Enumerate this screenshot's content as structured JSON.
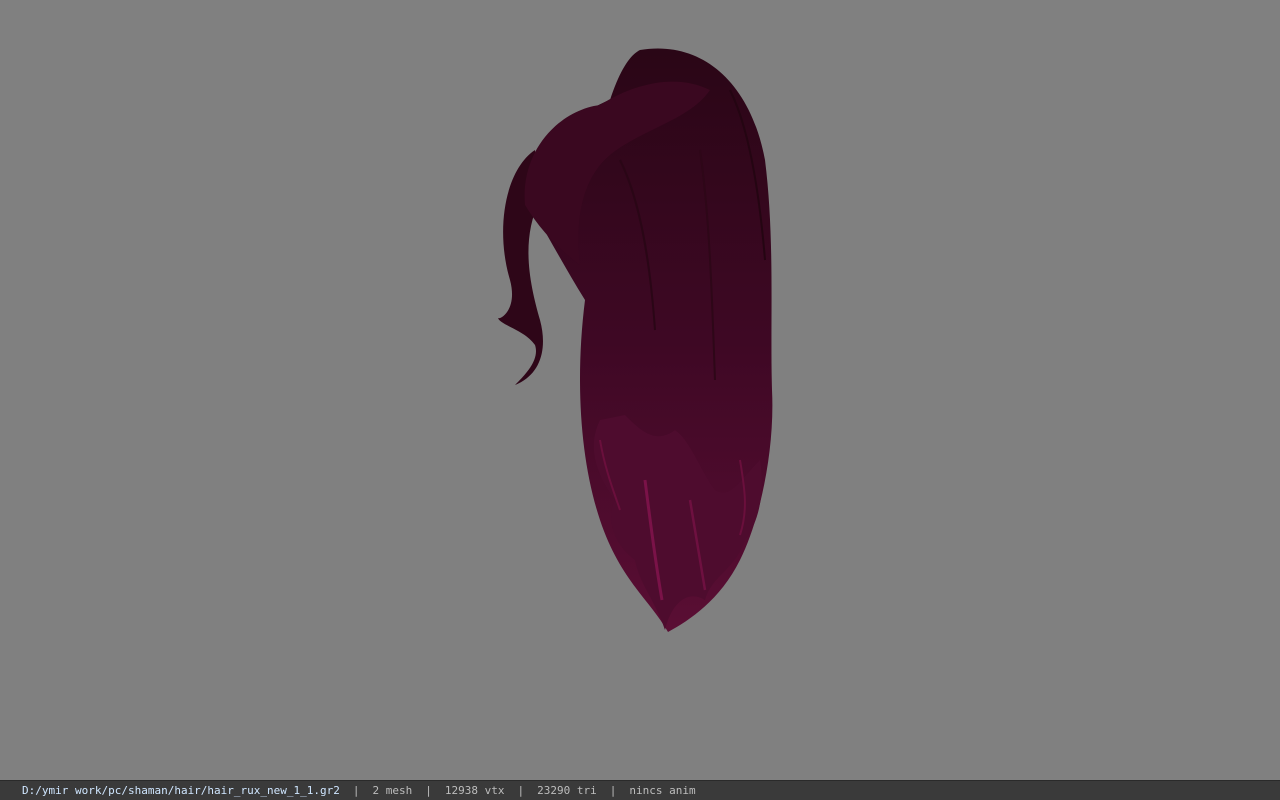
{
  "viewport": {
    "background_color": "#808080",
    "model": {
      "icon": "hair-mesh",
      "base_color": "#4a0a2a",
      "highlight_color": "#7a1248",
      "shadow_color": "#1e0410"
    }
  },
  "statusbar": {
    "file_path": "D:/ymir work/pc/shaman/hair/hair_rux_new_1_1.gr2",
    "separator": "|",
    "mesh_count": "2 mesh",
    "vertex_count": "12938 vtx",
    "triangle_count": "23290 tri",
    "anim_status": "nincs anim"
  }
}
